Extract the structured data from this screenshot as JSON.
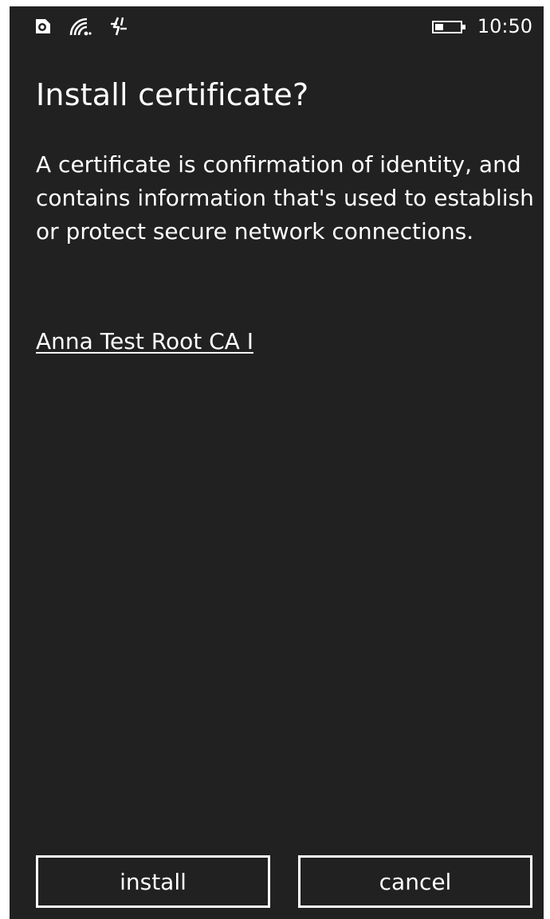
{
  "status_bar": {
    "icons": [
      "sim-icon",
      "wifi-icon",
      "data-sync-icon"
    ],
    "battery_icon": "battery-icon",
    "time": "10:50"
  },
  "dialog": {
    "title": "Install certificate?",
    "description": "A certificate is confirmation of identity, and contains information that's used to establish or protect secure network connections.",
    "certificate_link": "Anna Test Root CA I"
  },
  "buttons": {
    "install_label": "install",
    "cancel_label": "cancel"
  },
  "colors": {
    "background": "#212121",
    "text": "#ffffff",
    "page_border": "#ffffff"
  }
}
